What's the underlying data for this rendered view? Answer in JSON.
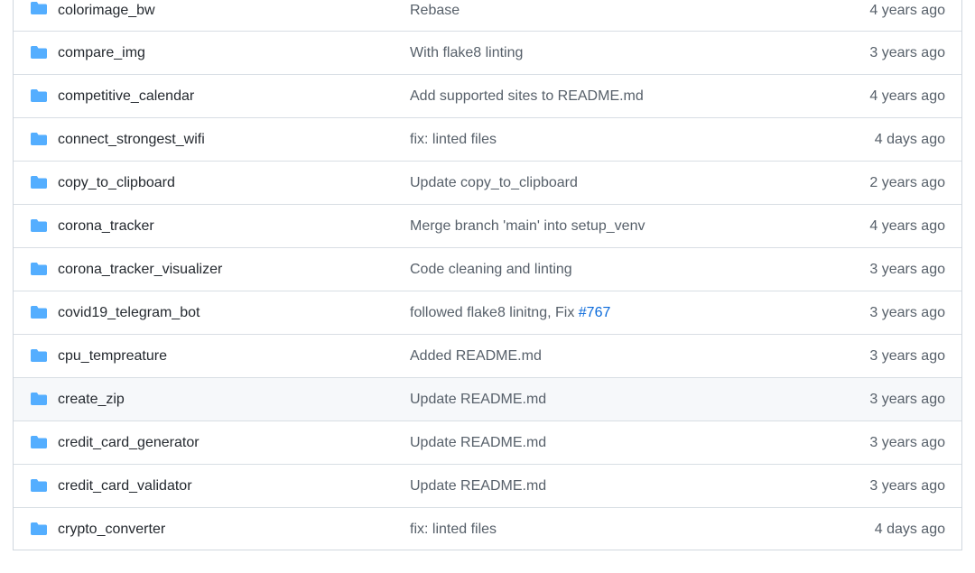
{
  "colors": {
    "folder_icon": "#54aeff",
    "link": "#0969da",
    "muted_text": "#57606a",
    "border": "#d0d7de",
    "hover_row": "#f6f8fa"
  },
  "rows": [
    {
      "icon": "folder-icon",
      "name": "colorimage_bw",
      "commit": "Rebase",
      "issue": "",
      "age": "4 years ago"
    },
    {
      "icon": "folder-icon",
      "name": "compare_img",
      "commit": "With flake8 linting",
      "issue": "",
      "age": "3 years ago"
    },
    {
      "icon": "folder-icon",
      "name": "competitive_calendar",
      "commit": "Add supported sites to README.md",
      "issue": "",
      "age": "4 years ago"
    },
    {
      "icon": "folder-icon",
      "name": "connect_strongest_wifi",
      "commit": "fix: linted files",
      "issue": "",
      "age": "4 days ago"
    },
    {
      "icon": "folder-icon",
      "name": "copy_to_clipboard",
      "commit": "Update copy_to_clipboard",
      "issue": "",
      "age": "2 years ago"
    },
    {
      "icon": "folder-icon",
      "name": "corona_tracker",
      "commit": "Merge branch 'main' into setup_venv",
      "issue": "",
      "age": "4 years ago"
    },
    {
      "icon": "folder-icon",
      "name": "corona_tracker_visualizer",
      "commit": "Code cleaning and linting",
      "issue": "",
      "age": "3 years ago"
    },
    {
      "icon": "folder-icon",
      "name": "covid19_telegram_bot",
      "commit": "followed flake8 linitng, Fix ",
      "issue": "#767",
      "age": "3 years ago"
    },
    {
      "icon": "folder-icon",
      "name": "cpu_tempreature",
      "commit": "Added README.md",
      "issue": "",
      "age": "3 years ago"
    },
    {
      "icon": "folder-icon",
      "name": "create_zip",
      "commit": "Update README.md",
      "issue": "",
      "age": "3 years ago"
    },
    {
      "icon": "folder-icon",
      "name": "credit_card_generator",
      "commit": "Update README.md",
      "issue": "",
      "age": "3 years ago"
    },
    {
      "icon": "folder-icon",
      "name": "credit_card_validator",
      "commit": "Update README.md",
      "issue": "",
      "age": "3 years ago"
    },
    {
      "icon": "folder-icon",
      "name": "crypto_converter",
      "commit": "fix: linted files",
      "issue": "",
      "age": "4 days ago"
    }
  ]
}
